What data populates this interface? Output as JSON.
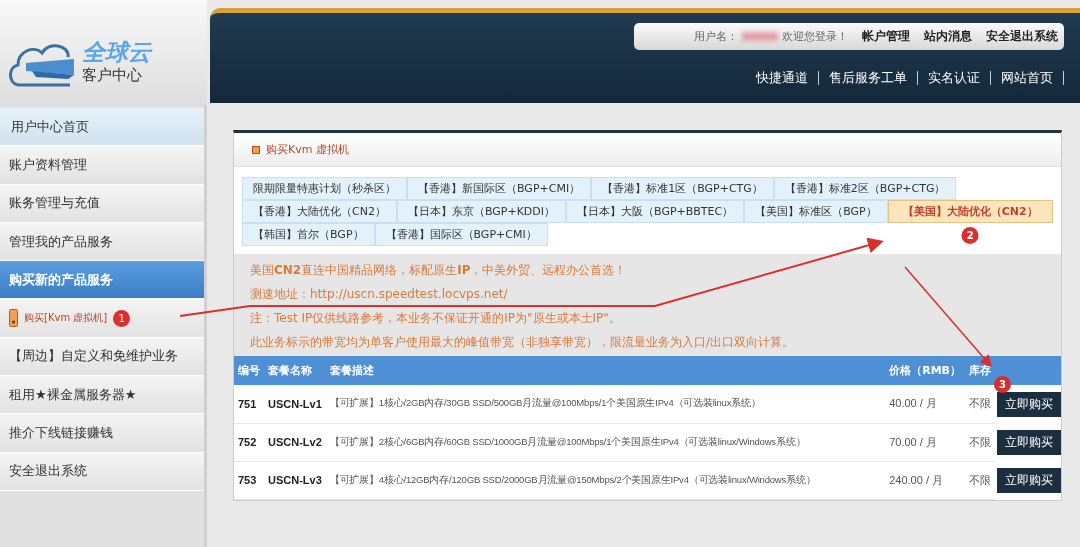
{
  "logo": {
    "title": "全球云",
    "subtitle": "客户中心"
  },
  "header": {
    "user_label": "用户名：",
    "welcome": "欢迎您登录！",
    "top_links": [
      "帐户管理",
      "站内消息",
      "安全退出系统"
    ],
    "nav": [
      "快捷通道",
      "售后服务工单",
      "实名认证",
      "网站首页"
    ]
  },
  "sidebar": {
    "items": [
      {
        "label": "用户中心首页",
        "kind": "home",
        "selected": false
      },
      {
        "label": "账户资料管理",
        "kind": "item",
        "selected": false
      },
      {
        "label": "账务管理与充值",
        "kind": "item",
        "selected": false
      },
      {
        "label": "管理我的产品服务",
        "kind": "item",
        "selected": false
      },
      {
        "label": "购买新的产品服务",
        "kind": "item",
        "selected": true
      },
      {
        "label": "购买[Kvm 虚拟机]",
        "kind": "sub",
        "selected": false,
        "badge": "1"
      },
      {
        "label": "【周边】自定义和免维护业务",
        "kind": "item",
        "selected": false
      },
      {
        "label": "租用★裸金属服务器★",
        "kind": "item",
        "selected": false
      },
      {
        "label": "推介下线链接赚钱",
        "kind": "item",
        "selected": false
      },
      {
        "label": "安全退出系统",
        "kind": "item",
        "selected": false
      }
    ]
  },
  "panel": {
    "title": "购买Kvm 虚拟机",
    "tab_rows": [
      [
        {
          "label": "限期限量特惠计划（秒杀区）",
          "selected": false
        },
        {
          "label": "【香港】新国际区（BGP+CMI）",
          "selected": false
        },
        {
          "label": "【香港】标准1区（BGP+CTG）",
          "selected": false
        },
        {
          "label": "【香港】标准2区（BGP+CTG）",
          "selected": false
        }
      ],
      [
        {
          "label": "【香港】大陆优化（CN2）",
          "selected": false
        },
        {
          "label": "【日本】东京（BGP+KDDI）",
          "selected": false
        },
        {
          "label": "【日本】大阪（BGP+BBTEC）",
          "selected": false
        },
        {
          "label": "【美国】标准区（BGP）",
          "selected": false
        },
        {
          "label": "【美国】大陆优化（CN2）",
          "selected": true,
          "badge": "2"
        }
      ],
      [
        {
          "label": "【韩国】首尔（BGP）",
          "selected": false
        },
        {
          "label": "【香港】国际区（BGP+CMI）",
          "selected": false
        }
      ]
    ],
    "notes": [
      {
        "text": "美国**CN2**直连中国精品网络，标配原生**IP**，中美外贸、远程办公首选！"
      },
      {
        "text": "测速地址：",
        "link": "http://uscn.speedtest.locvps.net/"
      },
      {
        "text": "注：Test IP仅供线路参考，本业务不保证开通的IP为\"原生或本土IP\"。"
      },
      {
        "text": "此业务标示的带宽均为单客户使用最大的峰值带宽（非独享带宽），限流量业务为入口/出口双向计算。"
      }
    ],
    "table": {
      "columns": [
        "编号",
        "套餐名称",
        "套餐描述",
        "价格（RMB）",
        "库存"
      ],
      "header_badge": "3",
      "rows": [
        {
          "id": "751",
          "name": "USCN-Lv1",
          "description": "【可扩展】1核心/2GB内存/30GB SSD/500GB月流量@100Mbps/1个美国原生IPv4（可选装linux系统）",
          "price": "40.00 / 月",
          "stock": "不限",
          "button": "立即购买"
        },
        {
          "id": "752",
          "name": "USCN-Lv2",
          "description": "【可扩展】2核心/6GB内存/60GB SSD/1000GB月流量@100Mbps/1个美国原生IPv4（可选装linux/Windows系统）",
          "price": "70.00 / 月",
          "stock": "不限",
          "button": "立即购买"
        },
        {
          "id": "753",
          "name": "USCN-Lv3",
          "description": "【可扩展】4核心/12GB内存/120GB SSD/2000GB月流量@150Mbps/2个美国原生IPv4（可选装linux/Windows系统）",
          "price": "240.00 / 月",
          "stock": "不限",
          "button": "立即购买"
        }
      ]
    }
  }
}
